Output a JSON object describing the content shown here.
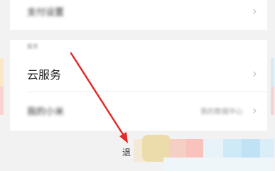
{
  "settings": {
    "top_row": {
      "label": "支付设置"
    },
    "service_section": {
      "header": "服务",
      "cloud": {
        "label": "云服务"
      },
      "xiaomi": {
        "label": "我的小米",
        "value": "我的数据中心"
      }
    },
    "logout": {
      "label": "退"
    }
  },
  "colors": {
    "arrow": "#e02b2b",
    "background": "#f2f2f2",
    "card": "#ffffff"
  },
  "icons": {
    "chevron": "chevron-right-icon",
    "arrow": "red-arrow-annotation"
  }
}
